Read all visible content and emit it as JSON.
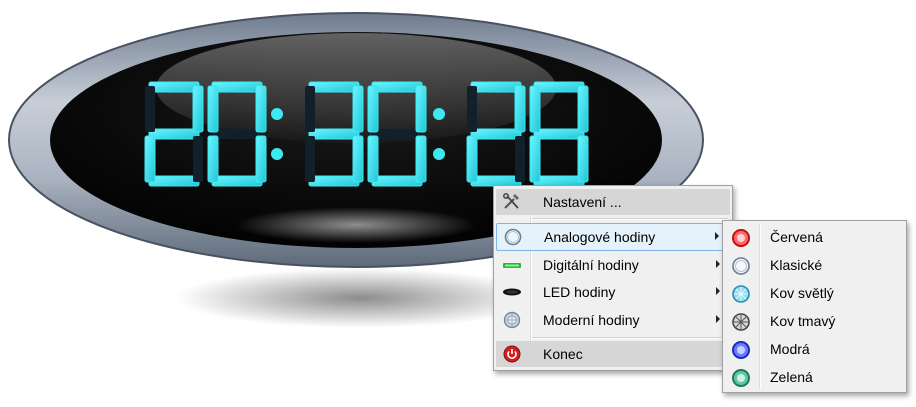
{
  "clock": {
    "time": [
      "2",
      "0",
      "3",
      "0",
      "2",
      "8"
    ],
    "separator": ":"
  },
  "context_menu": {
    "items": [
      {
        "label": "Nastavení ...",
        "icon": "tools-icon",
        "submenu": false
      },
      {
        "label": "Analogové hodiny",
        "icon": "analog-clock-icon",
        "submenu": true
      },
      {
        "label": "Digitální hodiny",
        "icon": "digital-clock-icon",
        "submenu": true
      },
      {
        "label": "LED hodiny",
        "icon": "led-clock-icon",
        "submenu": true
      },
      {
        "label": "Moderní hodiny",
        "icon": "modern-clock-icon",
        "submenu": true
      },
      {
        "label": "Konec",
        "icon": "power-icon",
        "submenu": false
      }
    ]
  },
  "submenu": {
    "items": [
      {
        "label": "Červená",
        "icon": "red-clock-icon",
        "color": "#e02020"
      },
      {
        "label": "Klasické",
        "icon": "classic-clock-icon",
        "color": "#9fb4c8"
      },
      {
        "label": "Kov světlý",
        "icon": "light-metal-clock-icon",
        "color": "#3fb6d8"
      },
      {
        "label": "Kov tmavý",
        "icon": "dark-metal-clock-icon",
        "color": "#555555"
      },
      {
        "label": "Modrá",
        "icon": "blue-clock-icon",
        "color": "#3048e8"
      },
      {
        "label": "Zelená",
        "icon": "green-clock-icon",
        "color": "#2e9a78"
      }
    ]
  },
  "colors": {
    "digit": "#3ee8f0",
    "digit_dim": "#12202a",
    "menu_bg": "#f0f0f0",
    "hover_bg": "#e5f1fb",
    "hover_border": "#7eb4ea"
  }
}
